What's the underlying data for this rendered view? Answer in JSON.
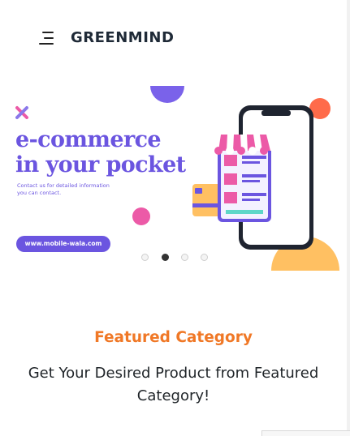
{
  "header": {
    "brand": "GREENMIND",
    "menu_icon": "hamburger-menu-icon"
  },
  "banner": {
    "headline_line1": "e-commerce",
    "headline_line2": "in your pocket",
    "subtext": "Contact us for detailed information you can contact.",
    "url": "www.mobile-wala.com",
    "colors": {
      "purple": "#6b55e0",
      "pink": "#ec5aa7",
      "orange": "#ff6b4a",
      "yellow": "#ffc062"
    },
    "carousel": {
      "slide_count": 4,
      "active_index": 1
    }
  },
  "featured": {
    "title": "Featured Category",
    "subtitle": "Get Your Desired Product from Featured Category!",
    "title_color": "#f07826"
  }
}
